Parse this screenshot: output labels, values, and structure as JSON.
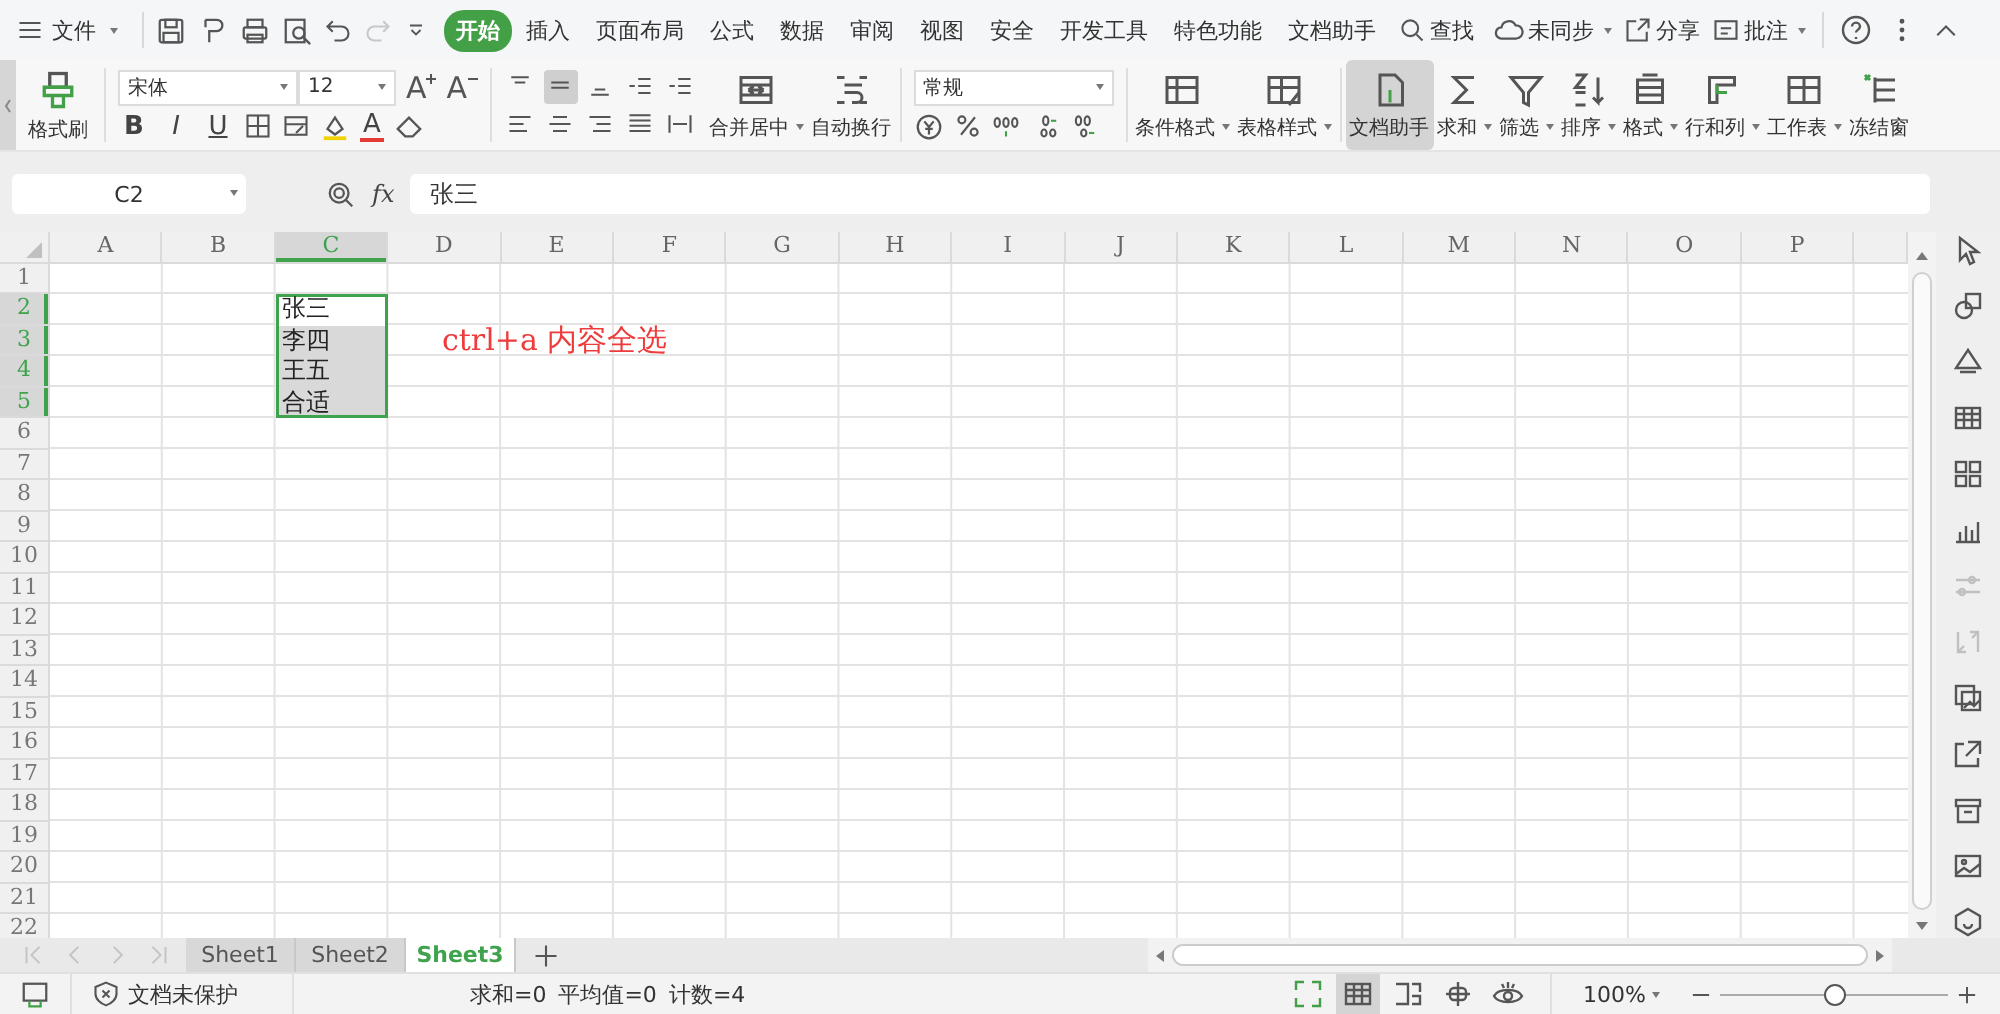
{
  "menu": {
    "file_label": "文件",
    "tabs": [
      {
        "label": "开始",
        "selected": true
      },
      {
        "label": "插入",
        "selected": false
      },
      {
        "label": "页面布局",
        "selected": false
      },
      {
        "label": "公式",
        "selected": false
      },
      {
        "label": "数据",
        "selected": false
      },
      {
        "label": "审阅",
        "selected": false
      },
      {
        "label": "视图",
        "selected": false
      },
      {
        "label": "安全",
        "selected": false
      },
      {
        "label": "开发工具",
        "selected": false
      },
      {
        "label": "特色功能",
        "selected": false
      },
      {
        "label": "文档助手",
        "selected": false
      }
    ],
    "search": "查找",
    "actions": [
      {
        "label": "未同步",
        "has_menu": true
      },
      {
        "label": "分享",
        "has_menu": false
      },
      {
        "label": "批注",
        "has_menu": true
      }
    ]
  },
  "ribbon": {
    "format_painter": "格式刷",
    "font_name": "宋体",
    "font_size": "12",
    "size_buttons": [
      {
        "label": "A",
        "kind": "grow"
      },
      {
        "label": "A",
        "kind": "shrink"
      }
    ],
    "style_buttons": [
      {
        "label": "B",
        "kind": "bold"
      },
      {
        "label": "I",
        "kind": "italic"
      },
      {
        "label": "U",
        "kind": "underline"
      }
    ],
    "font_color_label": "A",
    "align_buttons": [
      {
        "selected": false
      },
      {
        "selected": true
      },
      {
        "selected": false
      },
      {
        "selected": false
      },
      {
        "selected": false
      },
      {
        "selected": false
      },
      {
        "selected": false
      },
      {
        "selected": false
      },
      {
        "selected": false
      },
      {
        "selected": false
      }
    ],
    "merge_buttons": [
      {
        "label": "合并居中",
        "has_menu": true
      },
      {
        "label": "自动换行",
        "has_menu": false
      }
    ],
    "number_format": "常规",
    "tools": [
      {
        "label": "条件格式",
        "has_menu": true,
        "selected": false
      },
      {
        "label": "表格样式",
        "has_menu": true,
        "selected": false
      },
      {
        "label": "文档助手",
        "has_menu": false,
        "selected": true
      },
      {
        "label": "求和",
        "has_menu": true,
        "selected": false
      },
      {
        "label": "筛选",
        "has_menu": true,
        "selected": false
      },
      {
        "label": "排序",
        "has_menu": true,
        "selected": false
      },
      {
        "label": "格式",
        "has_menu": true,
        "selected": false
      },
      {
        "label": "行和列",
        "has_menu": true,
        "selected": false
      },
      {
        "label": "工作表",
        "has_menu": true,
        "selected": false
      },
      {
        "label": "冻结窗",
        "has_menu": false,
        "selected": false
      }
    ]
  },
  "formula_bar": {
    "name_box": "C2",
    "fx": "fx",
    "formula": "张三"
  },
  "grid": {
    "columns": [
      {
        "label": "A",
        "selected": false
      },
      {
        "label": "B",
        "selected": false
      },
      {
        "label": "C",
        "selected": true
      },
      {
        "label": "D",
        "selected": false
      },
      {
        "label": "E",
        "selected": false
      },
      {
        "label": "F",
        "selected": false
      },
      {
        "label": "G",
        "selected": false
      },
      {
        "label": "H",
        "selected": false
      },
      {
        "label": "I",
        "selected": false
      },
      {
        "label": "J",
        "selected": false
      },
      {
        "label": "K",
        "selected": false
      },
      {
        "label": "L",
        "selected": false
      },
      {
        "label": "M",
        "selected": false
      },
      {
        "label": "N",
        "selected": false
      },
      {
        "label": "O",
        "selected": false
      },
      {
        "label": "P",
        "selected": false
      }
    ],
    "rows": [
      {
        "label": "1",
        "selected": false
      },
      {
        "label": "2",
        "selected": true,
        "cells": [
          {},
          {},
          {
            "text": "张三",
            "selected": true,
            "active": true
          }
        ]
      },
      {
        "label": "3",
        "selected": true,
        "cells": [
          {},
          {},
          {
            "text": "李四",
            "selected": true,
            "active": false
          }
        ]
      },
      {
        "label": "4",
        "selected": true,
        "cells": [
          {},
          {},
          {
            "text": "王五",
            "selected": true,
            "active": false
          }
        ]
      },
      {
        "label": "5",
        "selected": true,
        "cells": [
          {},
          {},
          {
            "text": "合适",
            "selected": true,
            "active": false
          }
        ]
      },
      {
        "label": "6",
        "selected": false
      },
      {
        "label": "7",
        "selected": false
      },
      {
        "label": "8",
        "selected": false
      },
      {
        "label": "9",
        "selected": false
      },
      {
        "label": "10",
        "selected": false
      },
      {
        "label": "11",
        "selected": false
      },
      {
        "label": "12",
        "selected": false
      },
      {
        "label": "13",
        "selected": false
      },
      {
        "label": "14",
        "selected": false
      },
      {
        "label": "15",
        "selected": false
      },
      {
        "label": "16",
        "selected": false
      },
      {
        "label": "17",
        "selected": false
      },
      {
        "label": "18",
        "selected": false
      },
      {
        "label": "19",
        "selected": false
      },
      {
        "label": "20",
        "selected": false
      },
      {
        "label": "21",
        "selected": false
      },
      {
        "label": "22",
        "selected": false
      }
    ],
    "note": "ctrl+a 内容全选"
  },
  "side_panel": [
    {
      "disabled": false
    },
    {
      "disabled": false
    },
    {
      "disabled": false
    },
    {
      "disabled": false
    },
    {
      "disabled": false
    },
    {
      "disabled": false
    },
    {
      "disabled": true
    },
    {
      "disabled": true
    },
    {
      "disabled": false
    },
    {
      "disabled": false
    },
    {
      "disabled": false
    },
    {
      "disabled": false
    },
    {
      "disabled": false
    }
  ],
  "sheets": [
    {
      "label": "Sheet1",
      "selected": false
    },
    {
      "label": "Sheet2",
      "selected": false
    },
    {
      "label": "Sheet3",
      "selected": true
    }
  ],
  "status": {
    "protection": "文档未保护",
    "stats": [
      "求和=0",
      "平均值=0",
      "计数=4"
    ],
    "views": [
      {
        "selected": false
      },
      {
        "selected": true
      },
      {
        "selected": false
      },
      {
        "selected": false
      },
      {
        "selected": false
      }
    ],
    "zoom": "100%",
    "zoom_slider": {
      "level": 0.5
    }
  }
}
